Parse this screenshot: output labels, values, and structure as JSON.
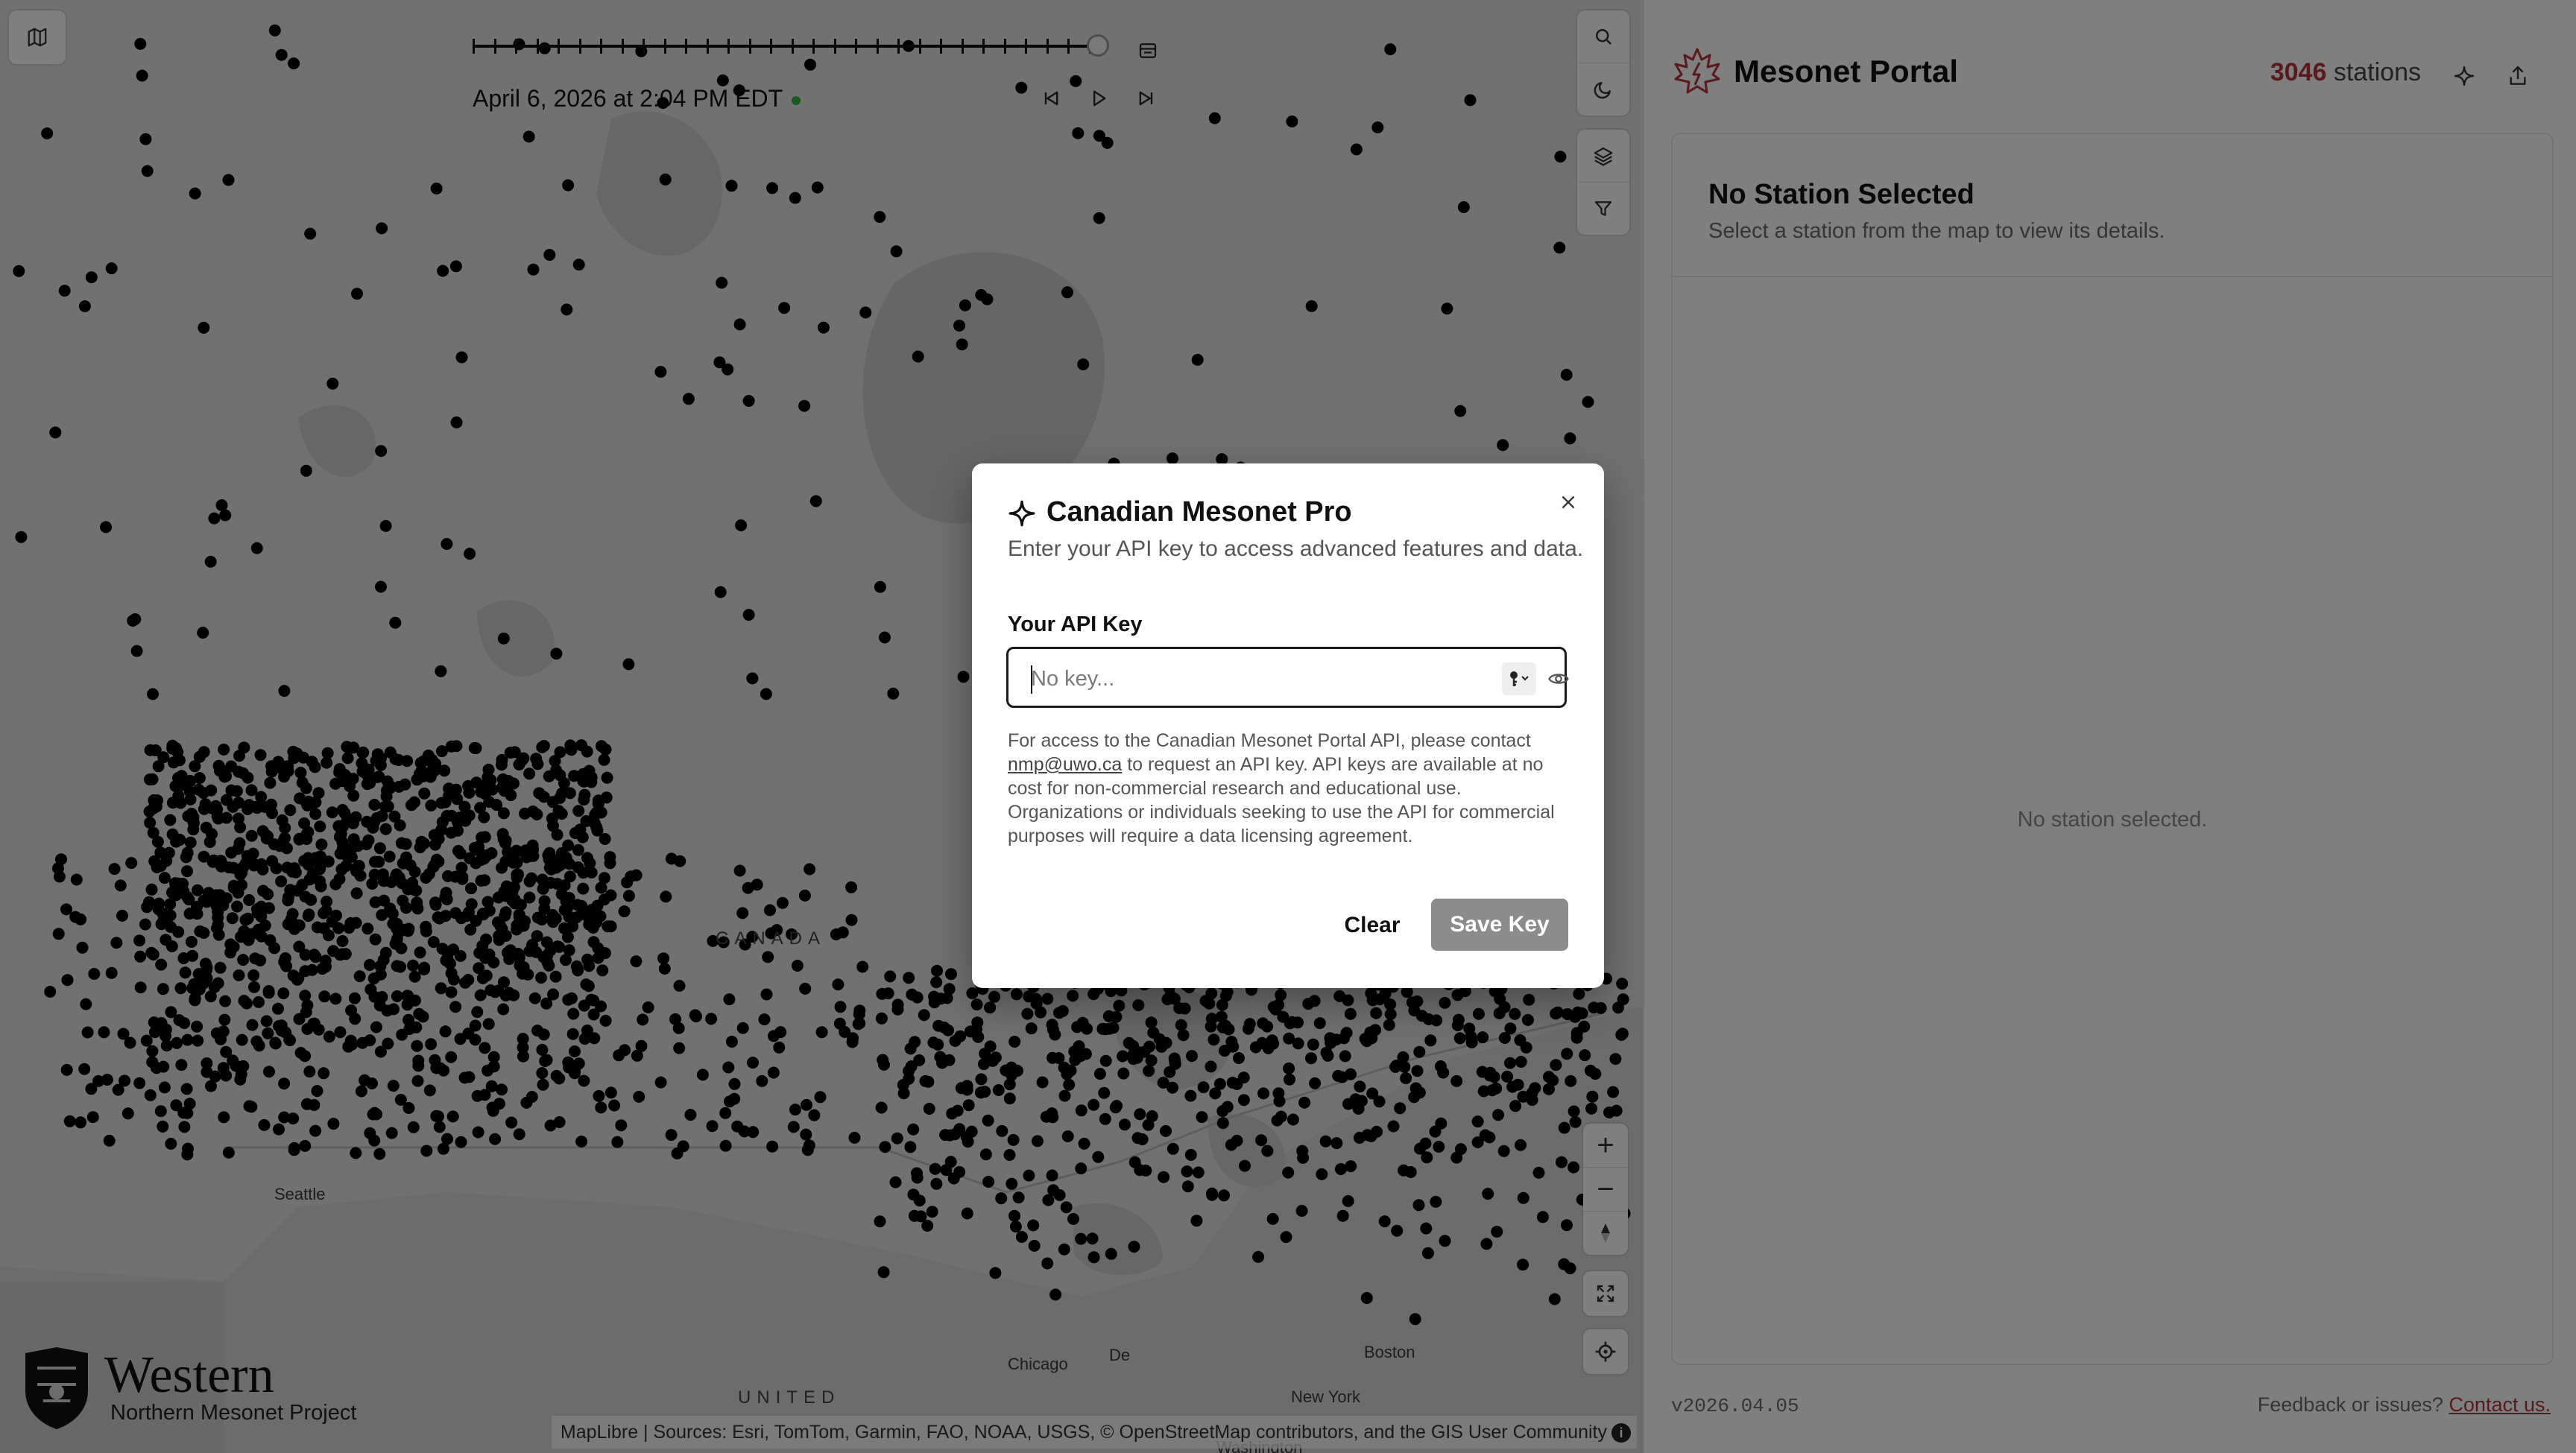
{
  "timeline": {
    "position": 1.0,
    "date_label": "April 6, 2026 at 2:04 PM EDT",
    "live_color": "#32b34a"
  },
  "map": {
    "labels": {
      "seattle": "Seattle",
      "chicago": "Chicago",
      "boston": "Boston",
      "new_york": "New York",
      "washington": "Washington",
      "canada": "CANADA",
      "united": "UNITED",
      "detroit": "De"
    },
    "attribution": "MapLibre | Sources: Esri, TomTom, Garmin, FAO, NOAA, USGS, © OpenStreetMap contributors, and the GIS User Community",
    "info_icon": "i",
    "logo_word": "Western",
    "logo_sub": "Northern Mesonet Project",
    "zoom_in": "+",
    "zoom_out": "−"
  },
  "panel": {
    "app_title": "Mesonet Portal",
    "station_count": "3046",
    "station_suffix": "stations",
    "card_title": "No Station Selected",
    "card_subtitle": "Select a station from the map to view its details.",
    "empty_message": "No station selected.",
    "version": "v2026.04.05",
    "feedback_text": "Feedback or issues?",
    "feedback_link": "Contact us.",
    "accent_color": "#b2333a"
  },
  "modal": {
    "title": "Canadian Mesonet Pro",
    "description": "Enter your API key to access advanced features and data.",
    "key_label": "Your API Key",
    "key_placeholder": "No key...",
    "key_value": "",
    "help_before": "For access to the Canadian Mesonet Portal API, please contact",
    "help_email": "nmp@uwo.ca",
    "help_after": "to request an API key. API keys are available at no cost for non-commercial research and educational use. Organizations or individuals seeking to use the API for commercial purposes will require a data licensing agreement.",
    "clear_label": "Clear",
    "save_label": "Save Key"
  }
}
